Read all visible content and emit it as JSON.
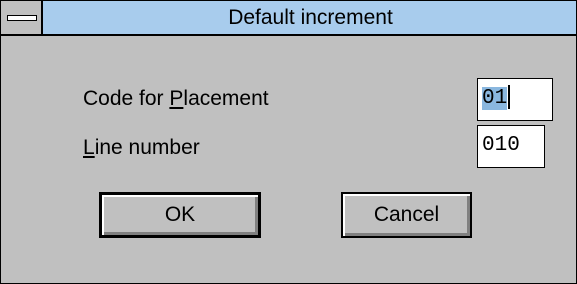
{
  "dialog": {
    "title": "Default increment",
    "fields": [
      {
        "label_prefix": "Code for ",
        "label_mnemonic": "P",
        "label_rest": "lacement",
        "value": "01"
      },
      {
        "label_prefix": "",
        "label_mnemonic": "L",
        "label_rest": "ine number",
        "value": "010"
      }
    ],
    "buttons": {
      "ok": "OK",
      "cancel": "Cancel"
    }
  },
  "colors": {
    "titlebar": "#a8cced",
    "face": "#c0c0c0",
    "selection": "#8ab7df"
  }
}
